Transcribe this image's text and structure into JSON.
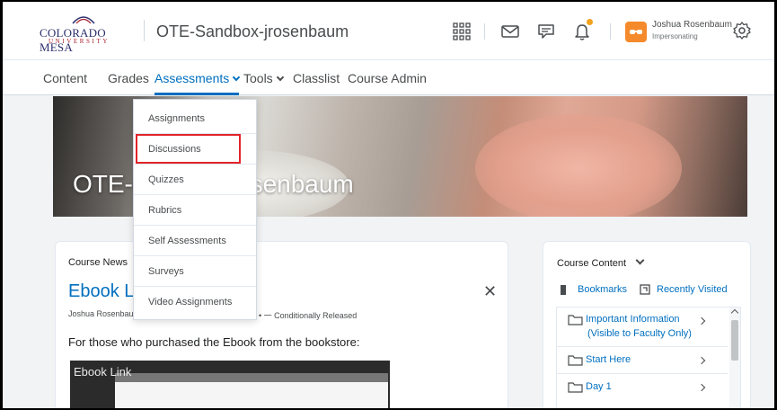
{
  "header": {
    "logo_main": "COLORADO MESA",
    "logo_sub": "UNIVERSITY",
    "org_title": "OTE-Sandbox-jrosenbaum",
    "user_name": "Joshua Rosenbaum",
    "user_role": "Impersonating",
    "accent_color": "#006fbf",
    "notification_dot_color": "#f3a21e",
    "avatar_color": "#f48a2c",
    "icons": [
      "waffle-icon",
      "mail-icon",
      "chat-icon",
      "bell-icon",
      "user-avatar-icon",
      "gear-icon"
    ]
  },
  "navbar": {
    "items": [
      {
        "label": "Content"
      },
      {
        "label": "Grades"
      },
      {
        "label": "Assessments"
      },
      {
        "label": "Tools"
      },
      {
        "label": "Classlist"
      },
      {
        "label": "Course Admin"
      }
    ],
    "active": "Assessments"
  },
  "dropdown": {
    "items": [
      {
        "label": "Assignments"
      },
      {
        "label": "Discussions"
      },
      {
        "label": "Quizzes"
      },
      {
        "label": "Rubrics"
      },
      {
        "label": "Self Assessments"
      },
      {
        "label": "Surveys"
      },
      {
        "label": "Video Assignments"
      }
    ],
    "highlighted": "Discussions",
    "highlight_color": "#e1232b"
  },
  "banner": {
    "title_left": "OTE-S",
    "title_right": "senbaum"
  },
  "news": {
    "heading": "Course News",
    "item_title": "Ebook Li",
    "author": "Joshua Rosenbaur",
    "meta_rest": "AM • ⼀ Conditionally Released",
    "body": "For those who purchased the Ebook from the bookstore:",
    "thumb_label": "Ebook Link"
  },
  "course_content": {
    "heading": "Course Content",
    "bookmarks": "Bookmarks",
    "recently_visited": "Recently Visited",
    "toc": [
      {
        "label_line1": "Important Information",
        "label_line2": "(Visible to Faculty Only)"
      },
      {
        "label_line1": "Start Here",
        "label_line2": ""
      },
      {
        "label_line1": "Day 1",
        "label_line2": ""
      }
    ]
  }
}
